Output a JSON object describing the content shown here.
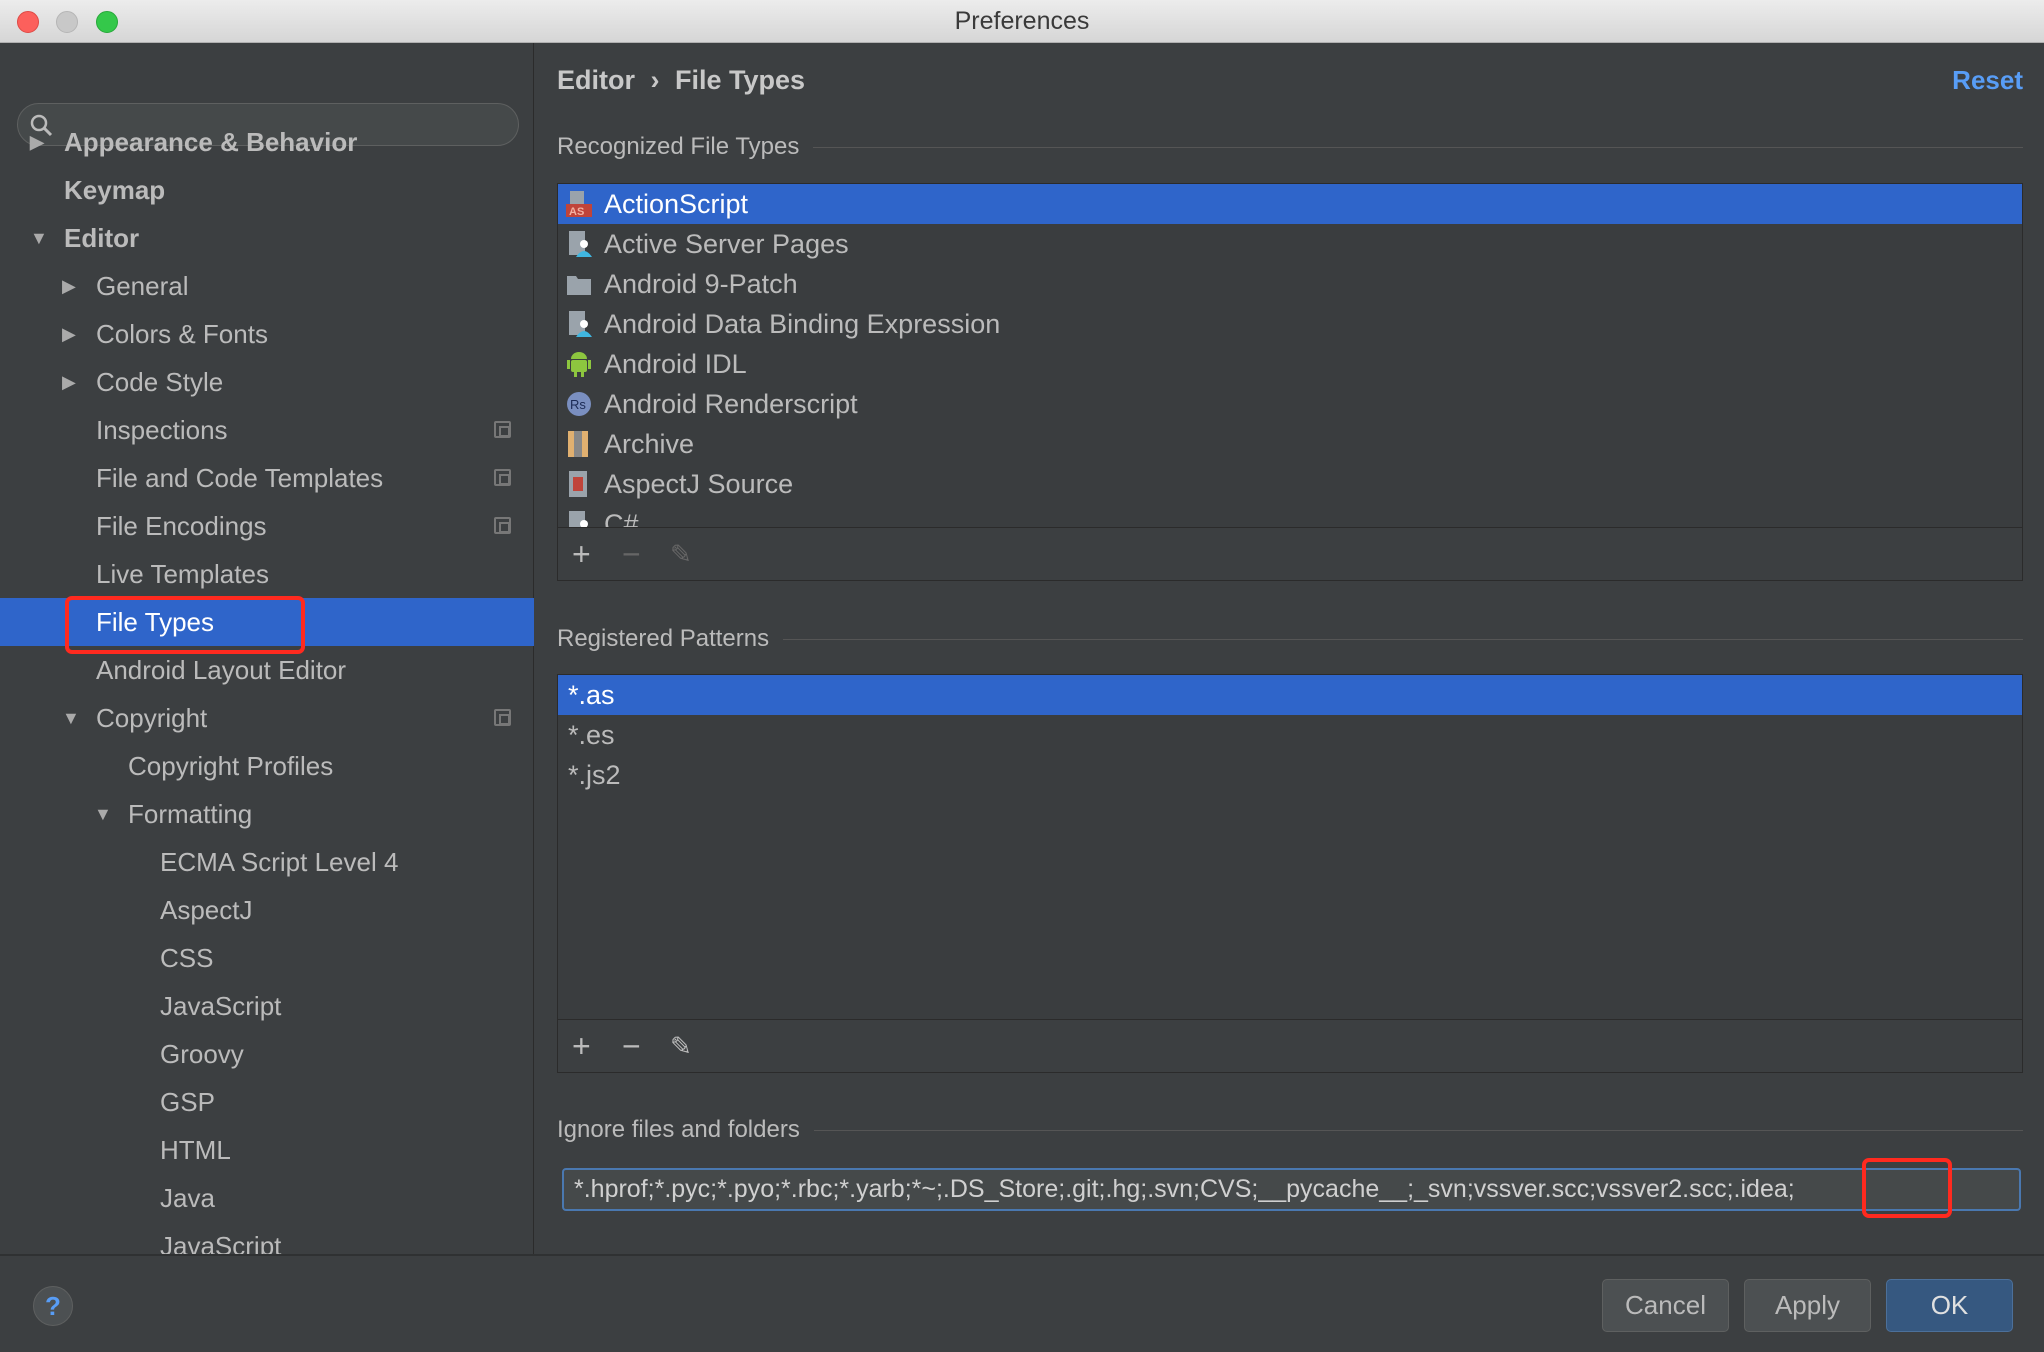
{
  "window": {
    "title": "Preferences"
  },
  "search": {
    "placeholder": ""
  },
  "sidebar": {
    "items": [
      {
        "label": "Appearance & Behavior",
        "level": 0,
        "expander": "collapsed",
        "bold": true
      },
      {
        "label": "Keymap",
        "level": 0,
        "expander": "none",
        "bold": true
      },
      {
        "label": "Editor",
        "level": 0,
        "expander": "expanded",
        "bold": true
      },
      {
        "label": "General",
        "level": 1,
        "expander": "collapsed"
      },
      {
        "label": "Colors & Fonts",
        "level": 1,
        "expander": "collapsed"
      },
      {
        "label": "Code Style",
        "level": 1,
        "expander": "collapsed"
      },
      {
        "label": "Inspections",
        "level": 1,
        "expander": "none",
        "project_icon": true
      },
      {
        "label": "File and Code Templates",
        "level": 1,
        "expander": "none",
        "project_icon": true
      },
      {
        "label": "File Encodings",
        "level": 1,
        "expander": "none",
        "project_icon": true
      },
      {
        "label": "Live Templates",
        "level": 1,
        "expander": "none"
      },
      {
        "label": "File Types",
        "level": 1,
        "expander": "none",
        "selected": true
      },
      {
        "label": "Android Layout Editor",
        "level": 1,
        "expander": "none"
      },
      {
        "label": "Copyright",
        "level": 1,
        "expander": "expanded",
        "project_icon": true
      },
      {
        "label": "Copyright Profiles",
        "level": 2,
        "expander": "none"
      },
      {
        "label": "Formatting",
        "level": 2,
        "expander": "expanded"
      },
      {
        "label": "ECMA Script Level 4",
        "level": 3,
        "expander": "none"
      },
      {
        "label": "AspectJ",
        "level": 3,
        "expander": "none"
      },
      {
        "label": "CSS",
        "level": 3,
        "expander": "none"
      },
      {
        "label": "JavaScript",
        "level": 3,
        "expander": "none"
      },
      {
        "label": "Groovy",
        "level": 3,
        "expander": "none"
      },
      {
        "label": "GSP",
        "level": 3,
        "expander": "none"
      },
      {
        "label": "HTML",
        "level": 3,
        "expander": "none"
      },
      {
        "label": "Java",
        "level": 3,
        "expander": "none"
      },
      {
        "label": "JavaScript",
        "level": 3,
        "expander": "none"
      }
    ]
  },
  "main": {
    "breadcrumb": [
      "Editor",
      "File Types"
    ],
    "breadcrumb_separator": "›",
    "reset_label": "Reset",
    "recognized": {
      "label": "Recognized File Types",
      "items": [
        {
          "label": "ActionScript",
          "icon": "actionscript-icon",
          "selected": true
        },
        {
          "label": "Active Server Pages",
          "icon": "web-file-icon"
        },
        {
          "label": "Android 9-Patch",
          "icon": "folder-icon"
        },
        {
          "label": "Android Data Binding Expression",
          "icon": "web-file-icon"
        },
        {
          "label": "Android IDL",
          "icon": "android-icon"
        },
        {
          "label": "Android Renderscript",
          "icon": "renderscript-icon"
        },
        {
          "label": "Archive",
          "icon": "archive-icon"
        },
        {
          "label": "AspectJ Source",
          "icon": "aspectj-icon"
        },
        {
          "label": "C#",
          "icon": "web-file-icon"
        }
      ]
    },
    "patterns": {
      "label": "Registered Patterns",
      "items": [
        {
          "label": "*.as",
          "selected": true
        },
        {
          "label": "*.es"
        },
        {
          "label": "*.js2"
        }
      ]
    },
    "toolbar": {
      "add": "+",
      "remove": "−",
      "edit": "✎"
    },
    "ignore": {
      "label": "Ignore files and folders",
      "value": "*.hprof;*.pyc;*.pyo;*.rbc;*.yarb;*~;.DS_Store;.git;.hg;.svn;CVS;__pycache__;_svn;vssver.scc;vssver2.scc;.idea;"
    }
  },
  "footer": {
    "help": "?",
    "cancel": "Cancel",
    "apply": "Apply",
    "ok": "OK"
  },
  "colors": {
    "selection": "#2f65ca",
    "link": "#589df6",
    "highlight": "#ff2a1f"
  }
}
